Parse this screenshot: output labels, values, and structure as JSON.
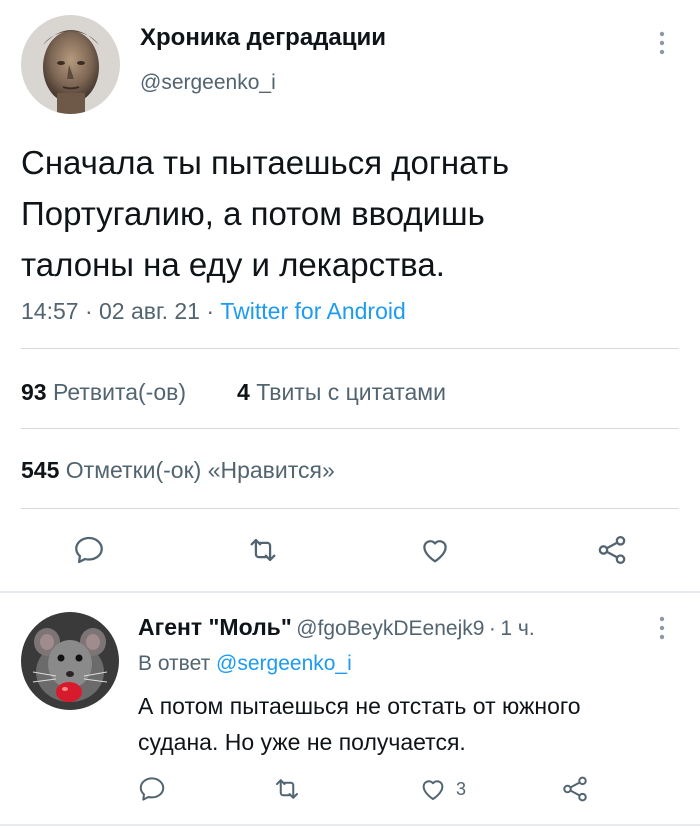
{
  "tweet": {
    "author_name": "Хроника деградации",
    "author_handle": "@sergeenko_i",
    "text_lines": [
      "Сначала ты пытаешься догнать",
      "Португалию, а потом вводишь",
      "талоны на еду и лекарства."
    ],
    "time": "14:57",
    "sep": "·",
    "date": "02 авг. 21",
    "source": "Twitter for Android",
    "retweets_count": "93",
    "retweets_label": "Ретвита(-ов)",
    "quotes_count": "4",
    "quotes_label": "Твиты с цитатами",
    "likes_count": "545",
    "likes_label": "Отметки(-ок) «Нравится»"
  },
  "reply": {
    "author_name": "Агент \"Моль\"",
    "author_handle": "@fgoBeykDEenejk9",
    "sep": "·",
    "time_ago": "1 ч.",
    "replying_to_label": "В ответ",
    "replying_to_handle": "@sergeenko_i",
    "text_lines": [
      "А потом пытаешься не отстать от южного",
      "судана. Но уже не получается."
    ],
    "like_count": "3"
  },
  "colors": {
    "accent": "#1d9bf0",
    "secondary_text": "#536471",
    "primary_text": "#0f1419",
    "divider": "#d5dbe0"
  },
  "icons": [
    "more-vertical-icon",
    "reply-icon",
    "retweet-icon",
    "like-icon",
    "share-icon"
  ]
}
